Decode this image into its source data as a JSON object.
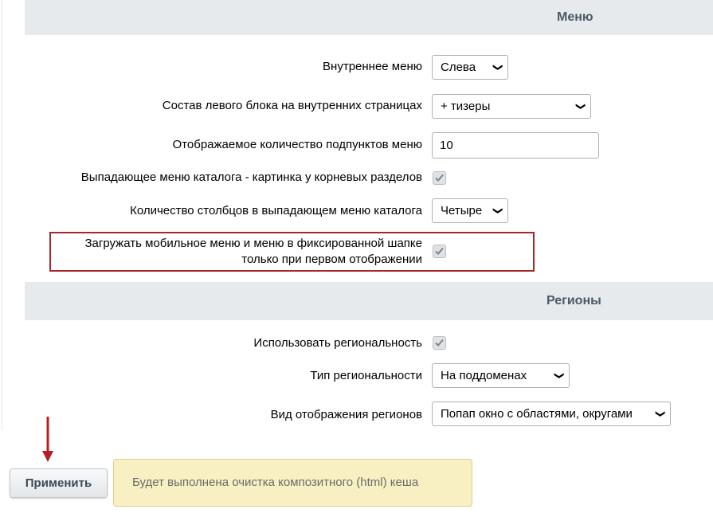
{
  "sections": {
    "menu": "Меню",
    "regions": "Регионы"
  },
  "menu": {
    "inner_menu": {
      "label": "Внутреннее меню",
      "value": "Слева"
    },
    "left_block": {
      "label": "Состав левого блока на внутренних страницах",
      "value": "+ тизеры"
    },
    "subitems_count": {
      "label": "Отображаемое количество подпунктов меню",
      "value": "10"
    },
    "catalog_picture": {
      "label": "Выпадающее меню каталога - картинка у корневых разделов",
      "checked": true
    },
    "catalog_columns": {
      "label": "Количество столбцов в выпадающем меню каталога",
      "value": "Четыре"
    },
    "lazy_load": {
      "label_line1": "Загружать мобильное меню и меню в фиксированной шапке",
      "label_line2": "только при первом отображении",
      "checked": true
    }
  },
  "regions": {
    "use_regions": {
      "label": "Использовать региональность",
      "checked": true
    },
    "region_type": {
      "label": "Тип региональности",
      "value": "На поддоменах"
    },
    "region_view": {
      "label": "Вид отображения регионов",
      "value": "Попап окно с областями, округами"
    }
  },
  "footer": {
    "apply_label": "Применить",
    "notice": "Будет выполнена очистка композитного (html) кеша"
  },
  "colors": {
    "section_bg": "#e7eaec",
    "highlight_border": "#a6262b",
    "notice_bg": "#f8f0c2",
    "arrow": "#b51f24"
  }
}
